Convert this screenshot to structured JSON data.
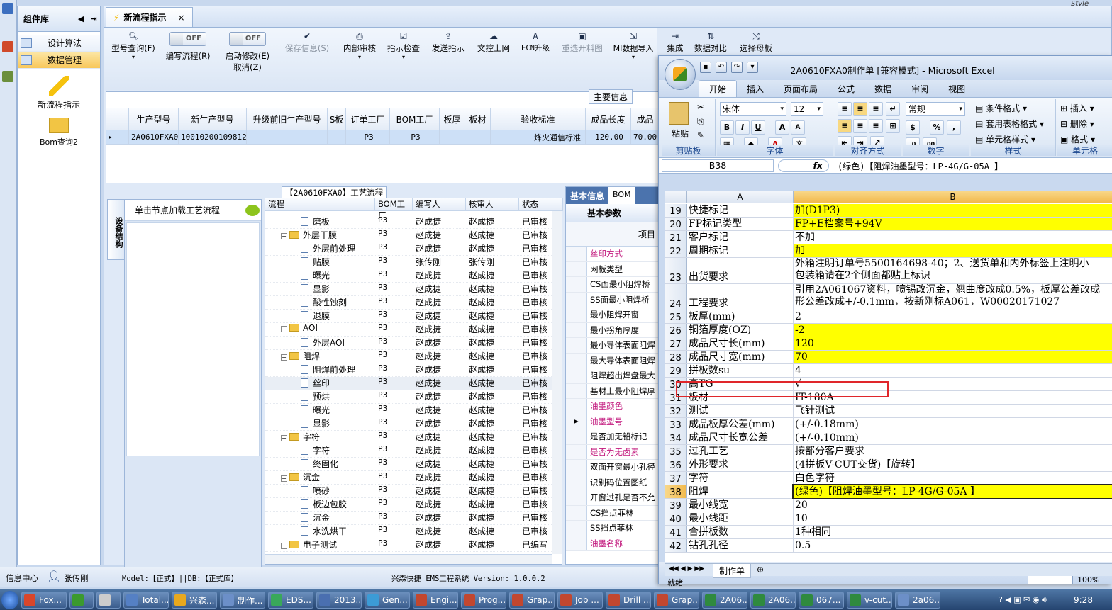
{
  "top_right_label": "Style",
  "component_panel": {
    "title": "组件库",
    "items": [
      "设计算法",
      "数据管理"
    ],
    "big_items": [
      "新流程指示",
      "Bom查询2"
    ]
  },
  "app": {
    "tab": "新流程指示",
    "toolbar": {
      "query": "型号查询(F)",
      "toggle1": "OFF",
      "write_flow": "编写流程(R)",
      "toggle2": "OFF",
      "start_modify": "启动修改(E)",
      "cancel_modify": "取消(Z)",
      "save_info": "保存信息(S)",
      "internal_review": "内部审核",
      "instr_check": "指示检查",
      "send_instr": "发送指示",
      "upload_doc": "文控上网",
      "ecn_upgrade": "ECN升级",
      "reselect_img": "重选开料图",
      "mi_import": "MI数据导入",
      "integrate": "集成",
      "data_compare": "数据对比",
      "select_master": "选择母板"
    },
    "main_info_label": "主要信息",
    "top_grid": {
      "headers": [
        "生产型号",
        "新生产型号",
        "升级前旧生产型号",
        "S板",
        "订单工厂",
        "BOM工厂",
        "板厚",
        "板材",
        "验收标准",
        "成品长度",
        "成品"
      ],
      "row": [
        "2A0610FXA0",
        "10010200109812",
        "",
        "",
        "P3",
        "P3",
        "",
        "",
        "烽火通信标准",
        "120.00",
        "70.00"
      ]
    },
    "side_tab": "设备结构",
    "side_header": "单击节点加载工艺流程",
    "process_title": "【2A0610FXA0】工艺流程",
    "process_headers": [
      "流程",
      "BOM工厂",
      "编写人",
      "核审人",
      "状态"
    ],
    "process_rows": [
      {
        "name": "磨板",
        "level": 2,
        "type": "doc",
        "bom": "P3",
        "writer": "赵成捷",
        "reviewer": "赵成捷",
        "status": "已审核"
      },
      {
        "name": "外层干膜",
        "level": 1,
        "type": "folder",
        "bom": "P3",
        "writer": "赵成捷",
        "reviewer": "赵成捷",
        "status": "已审核"
      },
      {
        "name": "外层前处理",
        "level": 2,
        "type": "doc",
        "bom": "P3",
        "writer": "赵成捷",
        "reviewer": "赵成捷",
        "status": "已审核"
      },
      {
        "name": "贴膜",
        "level": 2,
        "type": "doc",
        "bom": "P3",
        "writer": "张传刚",
        "reviewer": "张传刚",
        "status": "已审核"
      },
      {
        "name": "曝光",
        "level": 2,
        "type": "doc",
        "bom": "P3",
        "writer": "赵成捷",
        "reviewer": "赵成捷",
        "status": "已审核"
      },
      {
        "name": "显影",
        "level": 2,
        "type": "doc",
        "bom": "P3",
        "writer": "赵成捷",
        "reviewer": "赵成捷",
        "status": "已审核"
      },
      {
        "name": "酸性蚀刻",
        "level": 2,
        "type": "doc",
        "bom": "P3",
        "writer": "赵成捷",
        "reviewer": "赵成捷",
        "status": "已审核"
      },
      {
        "name": "退膜",
        "level": 2,
        "type": "doc",
        "bom": "P3",
        "writer": "赵成捷",
        "reviewer": "赵成捷",
        "status": "已审核"
      },
      {
        "name": "AOI",
        "level": 1,
        "type": "folder",
        "bom": "P3",
        "writer": "赵成捷",
        "reviewer": "赵成捷",
        "status": "已审核"
      },
      {
        "name": "外层AOI",
        "level": 2,
        "type": "doc",
        "bom": "P3",
        "writer": "赵成捷",
        "reviewer": "赵成捷",
        "status": "已审核"
      },
      {
        "name": "阻焊",
        "level": 1,
        "type": "folder",
        "bom": "P3",
        "writer": "赵成捷",
        "reviewer": "赵成捷",
        "status": "已审核"
      },
      {
        "name": "阻焊前处理",
        "level": 2,
        "type": "doc",
        "bom": "P3",
        "writer": "赵成捷",
        "reviewer": "赵成捷",
        "status": "已审核"
      },
      {
        "name": "丝印",
        "level": 2,
        "type": "doc",
        "bom": "P3",
        "writer": "赵成捷",
        "reviewer": "赵成捷",
        "status": "已审核",
        "selected": true
      },
      {
        "name": "预烘",
        "level": 2,
        "type": "doc",
        "bom": "P3",
        "writer": "赵成捷",
        "reviewer": "赵成捷",
        "status": "已审核"
      },
      {
        "name": "曝光",
        "level": 2,
        "type": "doc",
        "bom": "P3",
        "writer": "赵成捷",
        "reviewer": "赵成捷",
        "status": "已审核"
      },
      {
        "name": "显影",
        "level": 2,
        "type": "doc",
        "bom": "P3",
        "writer": "赵成捷",
        "reviewer": "赵成捷",
        "status": "已审核"
      },
      {
        "name": "字符",
        "level": 1,
        "type": "folder",
        "bom": "P3",
        "writer": "赵成捷",
        "reviewer": "赵成捷",
        "status": "已审核"
      },
      {
        "name": "字符",
        "level": 2,
        "type": "doc",
        "bom": "P3",
        "writer": "赵成捷",
        "reviewer": "赵成捷",
        "status": "已审核"
      },
      {
        "name": "终固化",
        "level": 2,
        "type": "doc",
        "bom": "P3",
        "writer": "赵成捷",
        "reviewer": "赵成捷",
        "status": "已审核"
      },
      {
        "name": "沉金",
        "level": 1,
        "type": "folder",
        "bom": "P3",
        "writer": "赵成捷",
        "reviewer": "赵成捷",
        "status": "已审核"
      },
      {
        "name": "喷砂",
        "level": 2,
        "type": "doc",
        "bom": "P3",
        "writer": "赵成捷",
        "reviewer": "赵成捷",
        "status": "已审核"
      },
      {
        "name": "板边包胶",
        "level": 2,
        "type": "doc",
        "bom": "P3",
        "writer": "赵成捷",
        "reviewer": "赵成捷",
        "status": "已审核"
      },
      {
        "name": "沉金",
        "level": 2,
        "type": "doc",
        "bom": "P3",
        "writer": "赵成捷",
        "reviewer": "赵成捷",
        "status": "已审核"
      },
      {
        "name": "水洗烘干",
        "level": 2,
        "type": "doc",
        "bom": "P3",
        "writer": "赵成捷",
        "reviewer": "赵成捷",
        "status": "已审核"
      },
      {
        "name": "电子测试",
        "level": 1,
        "type": "folder",
        "bom": "P3",
        "writer": "赵成捷",
        "reviewer": "赵成捷",
        "status": "已编写"
      }
    ],
    "basic_info": {
      "tab1": "基本信息",
      "tab2": "BOM",
      "subtab": "基本参数",
      "col_header": "项目",
      "rows": [
        {
          "label": "丝印方式",
          "pink": true
        },
        {
          "label": "网板类型",
          "pink": false
        },
        {
          "label": "CS面最小阻焊桥",
          "pink": false
        },
        {
          "label": "SS面最小阻焊桥",
          "pink": false
        },
        {
          "label": "最小阻焊开窗",
          "pink": false
        },
        {
          "label": "最小拐角厚度",
          "pink": false
        },
        {
          "label": "最小导体表面阻焊",
          "pink": false
        },
        {
          "label": "最大导体表面阻焊",
          "pink": false
        },
        {
          "label": "阻焊超出焊盘最大",
          "pink": false
        },
        {
          "label": "基材上最小阻焊厚",
          "pink": false
        },
        {
          "label": "油墨颜色",
          "pink": true
        },
        {
          "label": "油墨型号",
          "pink": true,
          "current": true
        },
        {
          "label": "是否加无铅标记",
          "pink": false
        },
        {
          "label": "是否为无卤素",
          "pink": true
        },
        {
          "label": "双面开窗最小孔径",
          "pink": false
        },
        {
          "label": "识别码位置图纸",
          "pink": false
        },
        {
          "label": "开窗过孔是否不允",
          "pink": false
        },
        {
          "label": "CS挡点菲林",
          "pink": false
        },
        {
          "label": "SS挡点菲林",
          "pink": false
        },
        {
          "label": "油墨名称",
          "pink": true
        }
      ]
    }
  },
  "status_bar": {
    "info_center": "信息中心",
    "user": "张传刚",
    "model": "Model:【正式】||DB:【正式库】",
    "version": "兴森快捷 EMS工程系统 Version: 1.0.0.2"
  },
  "excel": {
    "title": "2A0610FXA0制作单 [兼容模式] - Microsoft Excel",
    "tabs": [
      "开始",
      "插入",
      "页面布局",
      "公式",
      "数据",
      "审阅",
      "视图"
    ],
    "clipboard": {
      "paste": "粘贴",
      "label": "剪贴板"
    },
    "font": {
      "name": "宋体",
      "size": "12",
      "label": "字体"
    },
    "align_label": "对齐方式",
    "number": {
      "format": "常规",
      "label": "数字"
    },
    "styles": {
      "cond": "条件格式",
      "table": "套用表格格式",
      "cell": "单元格样式",
      "label": "样式"
    },
    "cells": {
      "insert": "插入",
      "delete": "删除",
      "format": "格式",
      "label": "单元格"
    },
    "name_box": "B38",
    "fx": "fx",
    "formula": "(绿色)【阻焊油墨型号：LP-4G/G-05A 】",
    "col_a": "A",
    "col_b": "B",
    "rows": [
      {
        "n": "19",
        "a": "快捷标记",
        "b": "加(D1P3)",
        "y": true,
        "h": 19
      },
      {
        "n": "20",
        "a": "FP标记类型",
        "b": "FP+E档案号+94V",
        "y": true,
        "h": 19
      },
      {
        "n": "21",
        "a": "客户标记",
        "b": "不加",
        "y": false,
        "h": 19
      },
      {
        "n": "22",
        "a": "周期标记",
        "b": "加",
        "y": true,
        "h": 19
      },
      {
        "n": "23",
        "a": "出货要求",
        "b": "外箱注明订单号5500164698-40；2、送货单和内外标签上注明小",
        "b2": "包装箱请在2个侧面都贴上标识",
        "y": false,
        "h": 37
      },
      {
        "n": "24",
        "a": "工程要求",
        "b": "引用2A061067资料，喷锡改沉金，翘曲度改成0.5%，板厚公差改成",
        "b2": "形公差改成+/-0.1mm，按新刚标A061，W00020171027",
        "y": false,
        "h": 37
      },
      {
        "n": "25",
        "a": "板厚(mm)",
        "b": "2",
        "y": false,
        "h": 19
      },
      {
        "n": "26",
        "a": "铜箔厚度(OZ)",
        "b": "-2",
        "y": true,
        "h": 19
      },
      {
        "n": "27",
        "a": "成品尺寸长(mm)",
        "b": "120",
        "y": true,
        "h": 19
      },
      {
        "n": "28",
        "a": "成品尺寸宽(mm)",
        "b": "70",
        "y": true,
        "h": 19
      },
      {
        "n": "29",
        "a": "拼板数su",
        "b": "4",
        "y": false,
        "h": 19
      },
      {
        "n": "30",
        "a": "高TG",
        "b": "√",
        "y": false,
        "h": 19
      },
      {
        "n": "31",
        "a": "板材",
        "b": "IT-180A",
        "y": false,
        "h": 19
      },
      {
        "n": "32",
        "a": "测试",
        "b": "飞针测试",
        "y": false,
        "h": 19
      },
      {
        "n": "33",
        "a": "成品板厚公差(mm)",
        "b": "(+/-0.18mm)",
        "y": false,
        "h": 19
      },
      {
        "n": "34",
        "a": "成品尺寸长宽公差",
        "b": "(+/-0.10mm)",
        "y": false,
        "h": 19
      },
      {
        "n": "35",
        "a": "过孔工艺",
        "b": "按部分客户要求",
        "y": false,
        "h": 19
      },
      {
        "n": "36",
        "a": "外形要求",
        "b": "(4拼板V-CUT交货)【旋转】",
        "y": false,
        "h": 19
      },
      {
        "n": "37",
        "a": "字符",
        "b": "白色字符",
        "y": false,
        "h": 19
      },
      {
        "n": "38",
        "a": "阻焊",
        "b": "(绿色)【阻焊油墨型号：LP-4G/G-05A 】",
        "y": true,
        "h": 19,
        "cur": true
      },
      {
        "n": "39",
        "a": "最小线宽",
        "b": "20",
        "y": false,
        "h": 19
      },
      {
        "n": "40",
        "a": "最小线距",
        "b": "10",
        "y": false,
        "h": 19
      },
      {
        "n": "41",
        "a": "合拼板数",
        "b": "1种相同",
        "y": false,
        "h": 19
      },
      {
        "n": "42",
        "a": "钻孔孔径",
        "b": "0.5",
        "y": false,
        "h": 19
      }
    ],
    "sheet_tab": "制作单",
    "status": "就绪",
    "zoom": "100%"
  },
  "taskbar": {
    "items": [
      "Fox...",
      "",
      "",
      "Total...",
      "兴森...",
      "制作...",
      "EDS...",
      "2013...",
      "Gen...",
      "Engi...",
      "Prog...",
      "Grap...",
      "Job ...",
      "Drill ...",
      "Grap...",
      "2A06...",
      "2A06...",
      "067...",
      "v-cut...",
      "2a06..."
    ],
    "clock": "9:28"
  }
}
